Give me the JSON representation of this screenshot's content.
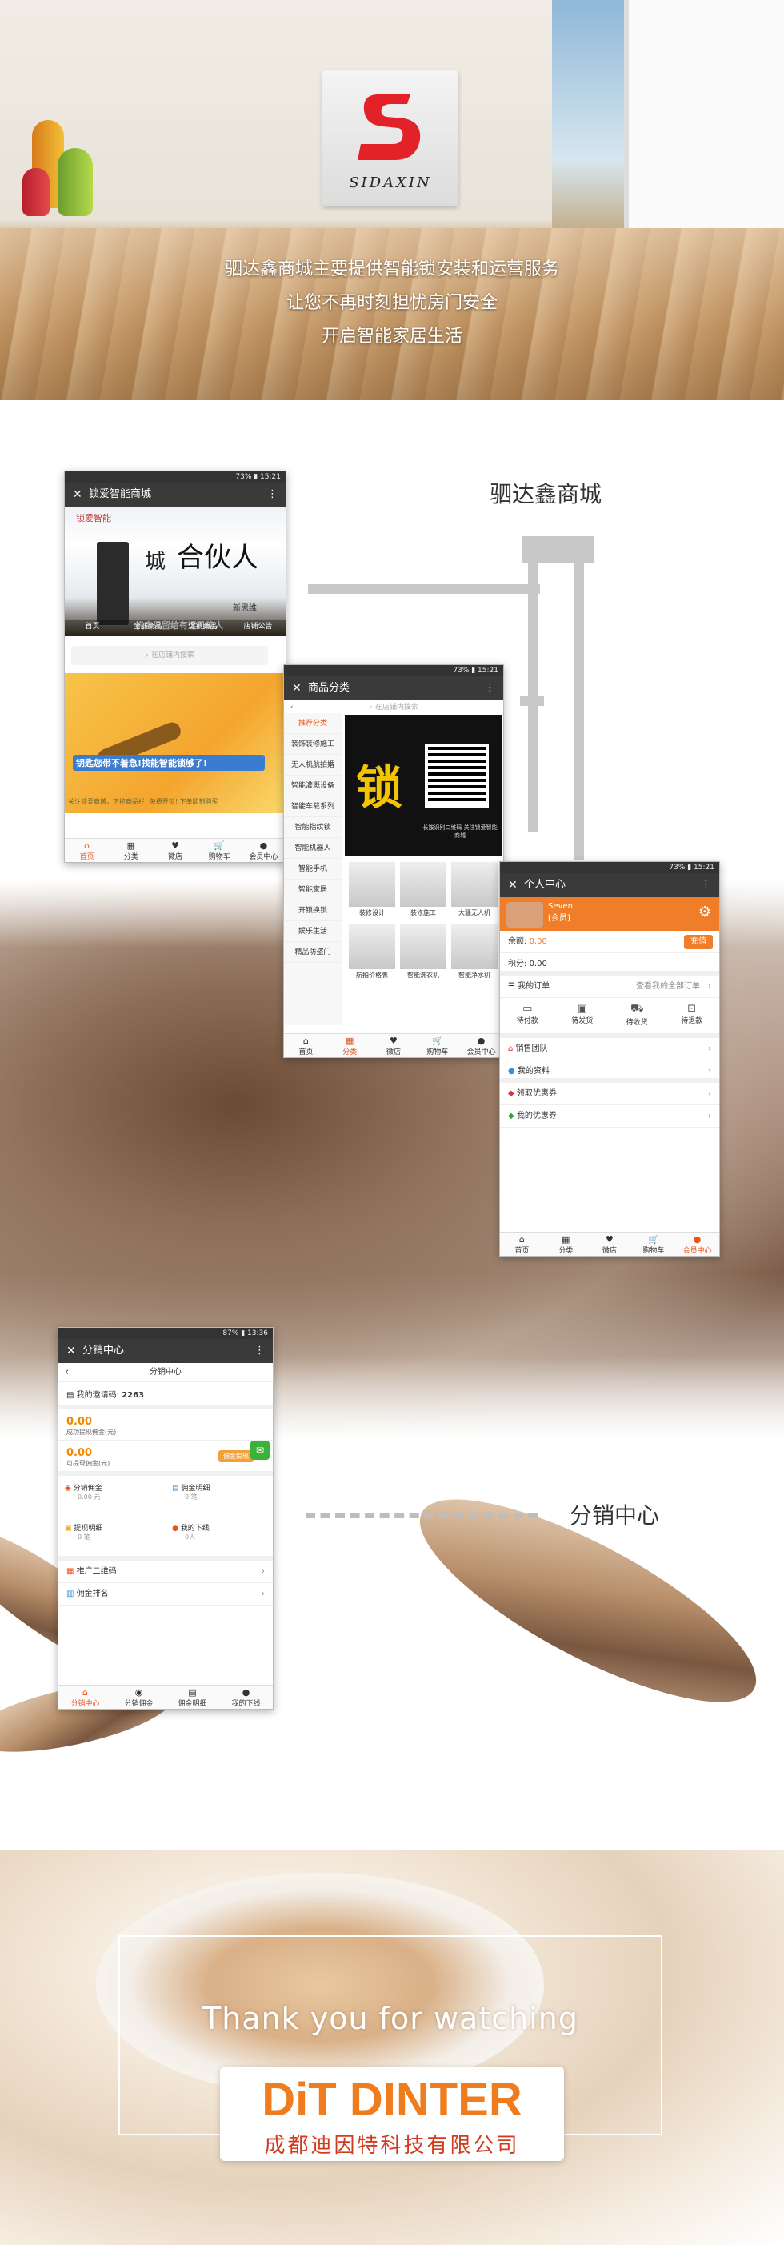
{
  "hero": {
    "logo_text": "SIDAXIN",
    "lines": [
      "驷达鑫商城主要提供智能锁安装和运营服务",
      "让您不再时刻担忧房门安全",
      "开启智能家居生活"
    ]
  },
  "sections": {
    "mall_title": "驷达鑫商城",
    "distribution_title": "分销中心"
  },
  "status": {
    "phone1": "73% ▮ 15:21",
    "phone2": "73% ▮ 15:21",
    "phone3": "73% ▮ 15:21",
    "phone4": "87% ▮ 13:36"
  },
  "home": {
    "title": "锁爱智能商城",
    "search_placeholder": "在店铺内搜索",
    "banner_texts": [
      "锁爱智能",
      "城",
      "合伙人",
      "机会只留给有远见的人",
      "新思维"
    ],
    "quick_links": [
      "首页",
      "全部商品",
      "促销商品",
      "店铺公告"
    ],
    "ad_text": "钥匙您带不着急!找能智能锁够了!",
    "ad_footer": "关注锁爱商城，下拉商品栏! 免费开锁! 下单即刻购买",
    "tabs": [
      "首页",
      "分类",
      "微店",
      "购物车",
      "会员中心"
    ]
  },
  "category": {
    "title": "商品分类",
    "search_placeholder": "在店铺内搜索",
    "items": [
      "推荐分类",
      "装饰装修施工",
      "无人机航拍婚",
      "智能灌溉设备",
      "智能车载系列",
      "智能指纹锁",
      "智能机器人",
      "智能手机",
      "智能家居",
      "开锁换锁",
      "娱乐生活",
      "精品防盗门"
    ],
    "banner_char": "锁",
    "banner_caption": "长按识别二维码 关注锁爱智能商城",
    "grid": [
      "装修设计",
      "装修施工",
      "大疆无人机",
      "航拍价格表",
      "智能洗衣机",
      "智能净水机"
    ],
    "tabs": [
      "首页",
      "分类",
      "微店",
      "购物车",
      "会员中心"
    ]
  },
  "member": {
    "title": "个人中心",
    "name": "Seven",
    "level": "[会员]",
    "balance_label": "余额:",
    "balance": "0.00",
    "recharge": "充值",
    "points_label": "积分:",
    "points": "0.00",
    "orders_label": "我的订单",
    "orders_link": "查看我的全部订单",
    "order_states": [
      "待付款",
      "待发货",
      "待收货",
      "待退款"
    ],
    "rows": [
      "销售团队",
      "我的资料",
      "领取优惠券",
      "我的优惠券"
    ],
    "tabs": [
      "首页",
      "分类",
      "微店",
      "购物车",
      "会员中心"
    ]
  },
  "distribution": {
    "title": "分销中心",
    "subtitle": "分销中心",
    "invite_label": "我的邀请码:",
    "invite_code": "2263",
    "amount1": "0.00",
    "amount1_label": "成功提现佣金(元)",
    "amount2": "0.00",
    "amount2_label": "可提现佣金(元)",
    "withdraw": "佣金提现",
    "cells": [
      {
        "title": "分销佣金",
        "sub": "0.00 元"
      },
      {
        "title": "佣金明细",
        "sub": "0 笔"
      },
      {
        "title": "提现明细",
        "sub": "0 笔"
      },
      {
        "title": "我的下线",
        "sub": "0人"
      }
    ],
    "rows": [
      "推广二维码",
      "佣金排名"
    ],
    "tabs": [
      "分销中心",
      "分销佣金",
      "佣金明细",
      "我的下线"
    ]
  },
  "footer": {
    "thanks": "Thank you for watching",
    "brand": "DiT DINTER",
    "company": "成都迪因特科技有限公司"
  }
}
